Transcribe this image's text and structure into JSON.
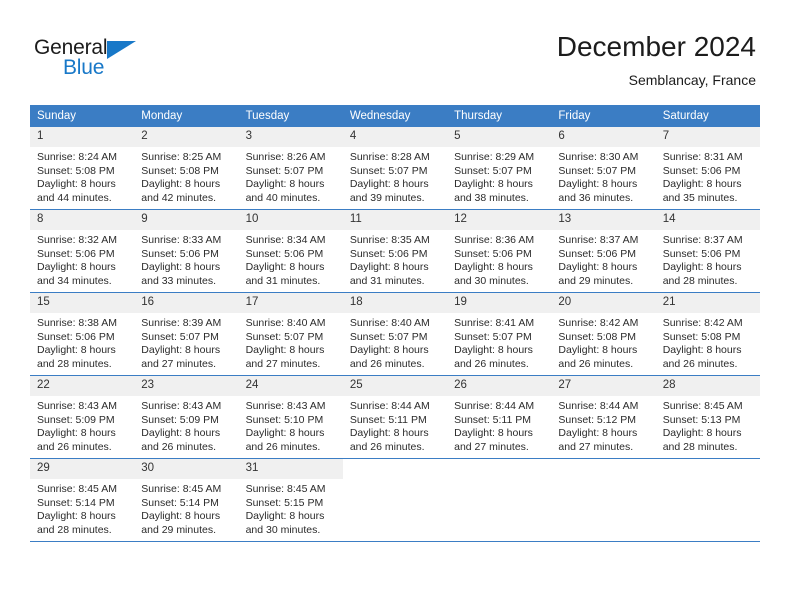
{
  "logo": {
    "text_primary": "General",
    "text_secondary": "Blue",
    "triangle_icon": "triangle-icon",
    "color_primary": "#1c1c1c",
    "color_secondary": "#1878c8"
  },
  "header": {
    "title": "December 2024",
    "subtitle": "Semblancay, France"
  },
  "theme": {
    "header_bg": "#3b7dc4",
    "daynum_bg": "#f0f0f0",
    "rule_color": "#3b7dc4",
    "text_color": "#2b2b2b"
  },
  "columns": [
    "Sunday",
    "Monday",
    "Tuesday",
    "Wednesday",
    "Thursday",
    "Friday",
    "Saturday"
  ],
  "weeks": [
    [
      {
        "day": "1",
        "sunrise": "Sunrise: 8:24 AM",
        "sunset": "Sunset: 5:08 PM",
        "daylight1": "Daylight: 8 hours",
        "daylight2": "and 44 minutes."
      },
      {
        "day": "2",
        "sunrise": "Sunrise: 8:25 AM",
        "sunset": "Sunset: 5:08 PM",
        "daylight1": "Daylight: 8 hours",
        "daylight2": "and 42 minutes."
      },
      {
        "day": "3",
        "sunrise": "Sunrise: 8:26 AM",
        "sunset": "Sunset: 5:07 PM",
        "daylight1": "Daylight: 8 hours",
        "daylight2": "and 40 minutes."
      },
      {
        "day": "4",
        "sunrise": "Sunrise: 8:28 AM",
        "sunset": "Sunset: 5:07 PM",
        "daylight1": "Daylight: 8 hours",
        "daylight2": "and 39 minutes."
      },
      {
        "day": "5",
        "sunrise": "Sunrise: 8:29 AM",
        "sunset": "Sunset: 5:07 PM",
        "daylight1": "Daylight: 8 hours",
        "daylight2": "and 38 minutes."
      },
      {
        "day": "6",
        "sunrise": "Sunrise: 8:30 AM",
        "sunset": "Sunset: 5:07 PM",
        "daylight1": "Daylight: 8 hours",
        "daylight2": "and 36 minutes."
      },
      {
        "day": "7",
        "sunrise": "Sunrise: 8:31 AM",
        "sunset": "Sunset: 5:06 PM",
        "daylight1": "Daylight: 8 hours",
        "daylight2": "and 35 minutes."
      }
    ],
    [
      {
        "day": "8",
        "sunrise": "Sunrise: 8:32 AM",
        "sunset": "Sunset: 5:06 PM",
        "daylight1": "Daylight: 8 hours",
        "daylight2": "and 34 minutes."
      },
      {
        "day": "9",
        "sunrise": "Sunrise: 8:33 AM",
        "sunset": "Sunset: 5:06 PM",
        "daylight1": "Daylight: 8 hours",
        "daylight2": "and 33 minutes."
      },
      {
        "day": "10",
        "sunrise": "Sunrise: 8:34 AM",
        "sunset": "Sunset: 5:06 PM",
        "daylight1": "Daylight: 8 hours",
        "daylight2": "and 31 minutes."
      },
      {
        "day": "11",
        "sunrise": "Sunrise: 8:35 AM",
        "sunset": "Sunset: 5:06 PM",
        "daylight1": "Daylight: 8 hours",
        "daylight2": "and 31 minutes."
      },
      {
        "day": "12",
        "sunrise": "Sunrise: 8:36 AM",
        "sunset": "Sunset: 5:06 PM",
        "daylight1": "Daylight: 8 hours",
        "daylight2": "and 30 minutes."
      },
      {
        "day": "13",
        "sunrise": "Sunrise: 8:37 AM",
        "sunset": "Sunset: 5:06 PM",
        "daylight1": "Daylight: 8 hours",
        "daylight2": "and 29 minutes."
      },
      {
        "day": "14",
        "sunrise": "Sunrise: 8:37 AM",
        "sunset": "Sunset: 5:06 PM",
        "daylight1": "Daylight: 8 hours",
        "daylight2": "and 28 minutes."
      }
    ],
    [
      {
        "day": "15",
        "sunrise": "Sunrise: 8:38 AM",
        "sunset": "Sunset: 5:06 PM",
        "daylight1": "Daylight: 8 hours",
        "daylight2": "and 28 minutes."
      },
      {
        "day": "16",
        "sunrise": "Sunrise: 8:39 AM",
        "sunset": "Sunset: 5:07 PM",
        "daylight1": "Daylight: 8 hours",
        "daylight2": "and 27 minutes."
      },
      {
        "day": "17",
        "sunrise": "Sunrise: 8:40 AM",
        "sunset": "Sunset: 5:07 PM",
        "daylight1": "Daylight: 8 hours",
        "daylight2": "and 27 minutes."
      },
      {
        "day": "18",
        "sunrise": "Sunrise: 8:40 AM",
        "sunset": "Sunset: 5:07 PM",
        "daylight1": "Daylight: 8 hours",
        "daylight2": "and 26 minutes."
      },
      {
        "day": "19",
        "sunrise": "Sunrise: 8:41 AM",
        "sunset": "Sunset: 5:07 PM",
        "daylight1": "Daylight: 8 hours",
        "daylight2": "and 26 minutes."
      },
      {
        "day": "20",
        "sunrise": "Sunrise: 8:42 AM",
        "sunset": "Sunset: 5:08 PM",
        "daylight1": "Daylight: 8 hours",
        "daylight2": "and 26 minutes."
      },
      {
        "day": "21",
        "sunrise": "Sunrise: 8:42 AM",
        "sunset": "Sunset: 5:08 PM",
        "daylight1": "Daylight: 8 hours",
        "daylight2": "and 26 minutes."
      }
    ],
    [
      {
        "day": "22",
        "sunrise": "Sunrise: 8:43 AM",
        "sunset": "Sunset: 5:09 PM",
        "daylight1": "Daylight: 8 hours",
        "daylight2": "and 26 minutes."
      },
      {
        "day": "23",
        "sunrise": "Sunrise: 8:43 AM",
        "sunset": "Sunset: 5:09 PM",
        "daylight1": "Daylight: 8 hours",
        "daylight2": "and 26 minutes."
      },
      {
        "day": "24",
        "sunrise": "Sunrise: 8:43 AM",
        "sunset": "Sunset: 5:10 PM",
        "daylight1": "Daylight: 8 hours",
        "daylight2": "and 26 minutes."
      },
      {
        "day": "25",
        "sunrise": "Sunrise: 8:44 AM",
        "sunset": "Sunset: 5:11 PM",
        "daylight1": "Daylight: 8 hours",
        "daylight2": "and 26 minutes."
      },
      {
        "day": "26",
        "sunrise": "Sunrise: 8:44 AM",
        "sunset": "Sunset: 5:11 PM",
        "daylight1": "Daylight: 8 hours",
        "daylight2": "and 27 minutes."
      },
      {
        "day": "27",
        "sunrise": "Sunrise: 8:44 AM",
        "sunset": "Sunset: 5:12 PM",
        "daylight1": "Daylight: 8 hours",
        "daylight2": "and 27 minutes."
      },
      {
        "day": "28",
        "sunrise": "Sunrise: 8:45 AM",
        "sunset": "Sunset: 5:13 PM",
        "daylight1": "Daylight: 8 hours",
        "daylight2": "and 28 minutes."
      }
    ],
    [
      {
        "day": "29",
        "sunrise": "Sunrise: 8:45 AM",
        "sunset": "Sunset: 5:14 PM",
        "daylight1": "Daylight: 8 hours",
        "daylight2": "and 28 minutes."
      },
      {
        "day": "30",
        "sunrise": "Sunrise: 8:45 AM",
        "sunset": "Sunset: 5:14 PM",
        "daylight1": "Daylight: 8 hours",
        "daylight2": "and 29 minutes."
      },
      {
        "day": "31",
        "sunrise": "Sunrise: 8:45 AM",
        "sunset": "Sunset: 5:15 PM",
        "daylight1": "Daylight: 8 hours",
        "daylight2": "and 30 minutes."
      },
      {
        "day": "",
        "sunrise": "",
        "sunset": "",
        "daylight1": "",
        "daylight2": ""
      },
      {
        "day": "",
        "sunrise": "",
        "sunset": "",
        "daylight1": "",
        "daylight2": ""
      },
      {
        "day": "",
        "sunrise": "",
        "sunset": "",
        "daylight1": "",
        "daylight2": ""
      },
      {
        "day": "",
        "sunrise": "",
        "sunset": "",
        "daylight1": "",
        "daylight2": ""
      }
    ]
  ]
}
